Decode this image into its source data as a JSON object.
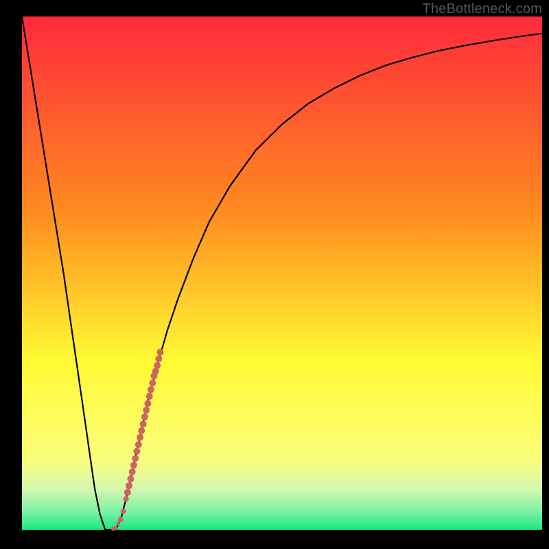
{
  "attribution": "TheBottleneck.com",
  "colors": {
    "frame": "#000000",
    "curve": "#000000",
    "dot": "#cb6462",
    "green_band": "#17e881",
    "pale_green": "#d6f7ae",
    "yellow": "#fffa33",
    "orange": "#ff8b1f",
    "red": "#ff2a3c"
  },
  "chart_data": {
    "type": "line",
    "title": "",
    "xlabel": "",
    "ylabel": "",
    "xlim": [
      0,
      100
    ],
    "ylim": [
      0,
      100
    ],
    "series": [
      {
        "name": "bottleneck-curve",
        "x": [
          0,
          4,
          8,
          12,
          13,
          14,
          15,
          16,
          17,
          18,
          19,
          20,
          22,
          24,
          26,
          28,
          30,
          33,
          36,
          40,
          45,
          50,
          55,
          60,
          65,
          70,
          75,
          80,
          85,
          90,
          95,
          100
        ],
        "y": [
          100,
          75,
          50,
          22,
          15,
          8,
          3,
          0,
          0,
          0,
          2,
          6,
          15,
          24,
          32,
          39,
          45,
          53,
          60,
          67,
          74,
          79,
          83,
          86,
          88.5,
          90.5,
          92,
          93.3,
          94.3,
          95.2,
          96,
          96.7
        ]
      }
    ],
    "scatter": {
      "name": "highlight-dots",
      "x": [
        17.5,
        18.0,
        18.5,
        19.0,
        19.5,
        20.0,
        20.3,
        20.6,
        20.9,
        21.2,
        21.5,
        21.8,
        22.1,
        22.4,
        22.7,
        23.0,
        23.3,
        23.6,
        23.9,
        24.2,
        24.5,
        24.8,
        25.1,
        25.4,
        25.7,
        26.0,
        26.3,
        26.6
      ],
      "y": [
        0.2,
        0.3,
        1.2,
        2.0,
        3.6,
        6.0,
        7.3,
        8.6,
        9.9,
        11.3,
        12.6,
        13.9,
        15.3,
        16.6,
        18.0,
        19.3,
        20.6,
        22.0,
        23.3,
        24.6,
        26.0,
        27.3,
        28.6,
        30.0,
        30.9,
        32.0,
        33.3,
        34.6
      ],
      "r": [
        3,
        3,
        3,
        4,
        4,
        4,
        5,
        5,
        5,
        5,
        5,
        5,
        5,
        5,
        5,
        5,
        5,
        5,
        5,
        5,
        5,
        5,
        5,
        5,
        5,
        5,
        5,
        5
      ]
    }
  }
}
